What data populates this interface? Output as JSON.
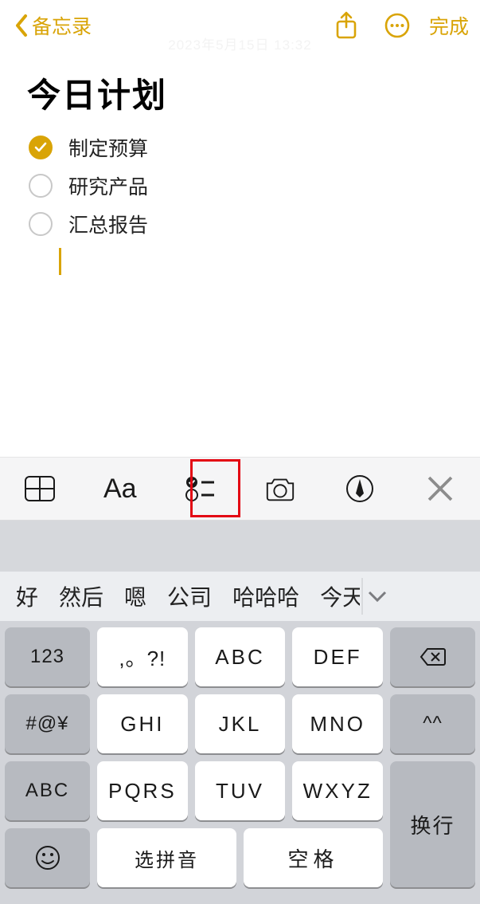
{
  "nav": {
    "back_label": "备忘录",
    "done_label": "完成",
    "watermark": "2023年5月15日 13:32"
  },
  "note": {
    "title": "今日计划",
    "items": [
      {
        "done": true,
        "text": "制定预算"
      },
      {
        "done": false,
        "text": "研究产品"
      },
      {
        "done": false,
        "text": "汇总报告"
      }
    ]
  },
  "toolbar": {
    "aa_label": "Aa"
  },
  "suggestions": [
    "好",
    "然后",
    "嗯",
    "公司",
    "哈哈哈",
    "今天"
  ],
  "keyboard": {
    "row1": {
      "side": "123",
      "keys": [
        ",。?!",
        "ABC",
        "DEF"
      ],
      "right": "backspace"
    },
    "row2": {
      "side": "#@¥",
      "keys": [
        "GHI",
        "JKL",
        "MNO"
      ],
      "right": "^^"
    },
    "row3": {
      "side": "ABC",
      "keys": [
        "PQRS",
        "TUV",
        "WXYZ"
      ]
    },
    "row4": {
      "emoji": "☺",
      "pinyin": "选拼音",
      "space": "空格",
      "enter": "换行"
    }
  }
}
